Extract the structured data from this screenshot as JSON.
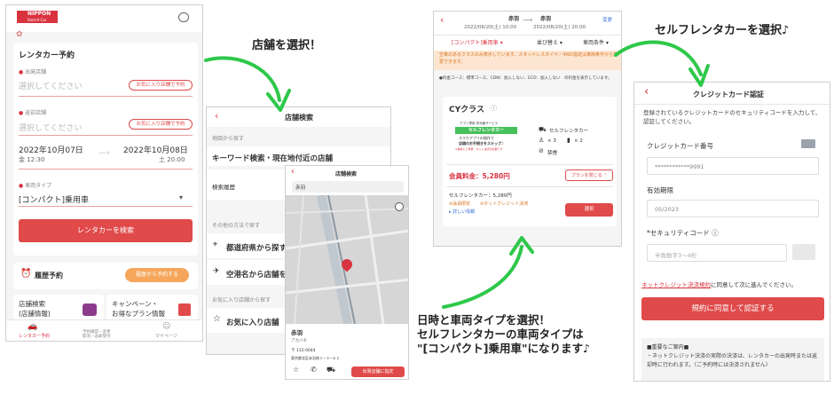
{
  "captions": {
    "select_store": "店舗を選択！",
    "select_rentacar": "セルフレンタカーを選択♪",
    "select_date_l1": "日時と車両タイプを選択！",
    "select_date_l2": "セルフレンタカーの車両タイプは",
    "select_date_l3": "\"[コンパクト]乗用車\"になります♪"
  },
  "screen1": {
    "logo": "NIPPON",
    "logo_sub": "Rent-A-Car",
    "title": "レンタカー予約",
    "departure_label": "出発店舗",
    "departure_placeholder": "選択してください",
    "favorite_btn": "お気に入り店舗で予約",
    "return_label": "返却店舗",
    "return_placeholder": "選択してください",
    "start_date": "2022年10月07日",
    "start_time": "金 12:30",
    "end_date": "2022年10月08日",
    "end_time": "土 20:00",
    "vehicle_label": "車両タイプ",
    "vehicle_value": "[コンパクト]乗用車",
    "search_btn": "レンタカーを検索",
    "history_title": "履歴予約",
    "history_btn": "履歴から予約する",
    "card1_l1": "店舗検索",
    "card1_l2": "(店舗情報)",
    "card2_l1": "キャンペーン・",
    "card2_l2": "お得なプラン情報",
    "nav": [
      "レンタカー予約",
      "予約確認・変更\n取消・返却受付",
      "マイページ"
    ]
  },
  "screen2": {
    "title": "店舗検索",
    "map_section": "地図から探す",
    "keyword_search": "キーワード検索・現在地付近の店舗",
    "history": "検索履歴",
    "other_section": "その他の方法で探す",
    "prefecture": "都道府県から探す",
    "airport": "空港名から店舗を探す",
    "favorite_section": "お気に入り店舗から探す",
    "favorite": "お気に入り店舗"
  },
  "screen3": {
    "title": "店舗検索",
    "search_value": "赤羽",
    "store_name": "赤羽",
    "store_kana": "アカバネ",
    "zip": "115-0044",
    "address": "東京都北区赤羽南１−３−６２",
    "depart_btn": "出発店舗に指定"
  },
  "screen4": {
    "from_store": "赤羽",
    "from_dt": "2022/08/20(土) 10:00",
    "to_store": "赤羽",
    "to_dt": "2022/08/20(土) 20:00",
    "change": "変更",
    "filter_type": "[コンパクト]乗用車",
    "filter_sort": "並び替え",
    "filter_cond": "車両条件",
    "notice": "空車のあるクラスのみ表示しています。スタッドレスタイヤ／4WD指定は車両条件から変更できます。",
    "fee_note": "●料金コース：標準コース、CDW：加入しない、ECO：加入しない　の料金を表示しています。",
    "class_name": "CYクラス",
    "banner_l1": "アプリ専用 非対面サービス",
    "banner_l2": "セルフレンタカー",
    "banner_l3": "スマホアプリの操作で",
    "banner_l4": "店頭のお手続きをスキップ♪",
    "banner_note": "※事前にご準備・ネット決済が必要です",
    "spec_type": "セルフレンタカー",
    "spec_seats": "× 3",
    "spec_bags": "× 2",
    "spec_smoke": "禁煙",
    "member_price": "会員料金：5,280円",
    "plan_btn": "プランを閉じる",
    "self_price": "セルフレンタカー：5,280円",
    "tag1": "会員限定",
    "tag2": "ネットクレジット決済",
    "detail": "詳しい情報",
    "select_btn": "選択"
  },
  "screen5": {
    "title": "クレジットカード認証",
    "intro": "登録されているクレジットカードのセキュリティコードを入力して、認証してください。",
    "card_label": "クレジットカード番号",
    "card_value": "************9991",
    "expiry_label": "有効期限",
    "expiry_value": "05/2023",
    "cvv_label": "セキュリティコード",
    "cvv_placeholder": "半角数字3〜4桁",
    "terms_link": "ネットクレジット決済規約",
    "terms_text": "に同意して次に進んでください。",
    "agree_btn": "規約に同意して認証する",
    "notice_title": "■重要なご案内■",
    "notice_body": "・ネットクレジット決済の実際の決済は、レンタカーの出発時または返却時に行われます。（ご予約時には決済されません）"
  },
  "colors": {
    "accent": "#e04a4a",
    "arrow": "#2ec84a",
    "text": "#333333"
  }
}
